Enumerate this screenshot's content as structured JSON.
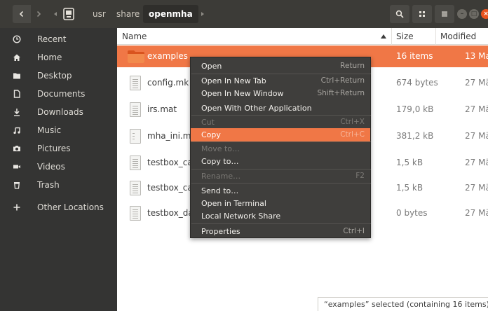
{
  "header": {
    "back_icon": "chevron-left-icon",
    "forward_icon": "chevron-right-icon",
    "crumbs": [
      "usr",
      "share",
      "openmha"
    ],
    "search_icon": "search-icon",
    "view_icon": "grid-view-icon",
    "menu_icon": "hamburger-menu-icon"
  },
  "sidebar": {
    "items": [
      {
        "label": "Recent",
        "icon": "clock-icon"
      },
      {
        "label": "Home",
        "icon": "home-icon"
      },
      {
        "label": "Desktop",
        "icon": "folder-icon"
      },
      {
        "label": "Documents",
        "icon": "document-icon"
      },
      {
        "label": "Downloads",
        "icon": "download-icon"
      },
      {
        "label": "Music",
        "icon": "music-icon"
      },
      {
        "label": "Pictures",
        "icon": "camera-icon"
      },
      {
        "label": "Videos",
        "icon": "video-icon"
      },
      {
        "label": "Trash",
        "icon": "trash-icon"
      },
      {
        "label": "Other Locations",
        "icon": "plus-icon"
      }
    ]
  },
  "columns": {
    "name": "Name",
    "size": "Size",
    "modified": "Modified"
  },
  "files": [
    {
      "name": "examples",
      "size": "16 items",
      "modified": "13 Ma",
      "type": "folder"
    },
    {
      "name": "config.mk",
      "size": "674 bytes",
      "modified": "27 Mä",
      "type": "text"
    },
    {
      "name": "irs.mat",
      "size": "179,0 kB",
      "modified": "27 Mä",
      "type": "text"
    },
    {
      "name": "mha_ini.ma",
      "size": "381,2 kB",
      "modified": "27 Mä",
      "type": "binary"
    },
    {
      "name": "testbox_ca",
      "size": "1,5 kB",
      "modified": "27 Mä",
      "type": "text"
    },
    {
      "name": "testbox_ca",
      "size": "1,5 kB",
      "modified": "27 Mä",
      "type": "text"
    },
    {
      "name": "testbox_da",
      "size": "0 bytes",
      "modified": "27 Mä",
      "type": "text"
    }
  ],
  "context_menu": {
    "open": {
      "label": "Open",
      "shortcut": "Return"
    },
    "open_new_tab": {
      "label": "Open In New Tab",
      "shortcut": "Ctrl+Return"
    },
    "open_new_window": {
      "label": "Open In New Window",
      "shortcut": "Shift+Return"
    },
    "open_with": {
      "label": "Open With Other Application"
    },
    "cut": {
      "label": "Cut",
      "shortcut": "Ctrl+X"
    },
    "copy": {
      "label": "Copy",
      "shortcut": "Ctrl+C"
    },
    "move_to": {
      "label": "Move to…"
    },
    "copy_to": {
      "label": "Copy to…"
    },
    "rename": {
      "label": "Rename…",
      "shortcut": "F2"
    },
    "send_to": {
      "label": "Send to…"
    },
    "open_terminal": {
      "label": "Open in Terminal"
    },
    "local_share": {
      "label": "Local Network Share"
    },
    "properties": {
      "label": "Properties",
      "shortcut": "Ctrl+I"
    }
  },
  "status": "“examples” selected  (containing 16 items)",
  "colors": {
    "accent": "#f07746",
    "header": "#3c3b37",
    "sidebar": "#343433",
    "menu": "#3f3e3c"
  }
}
